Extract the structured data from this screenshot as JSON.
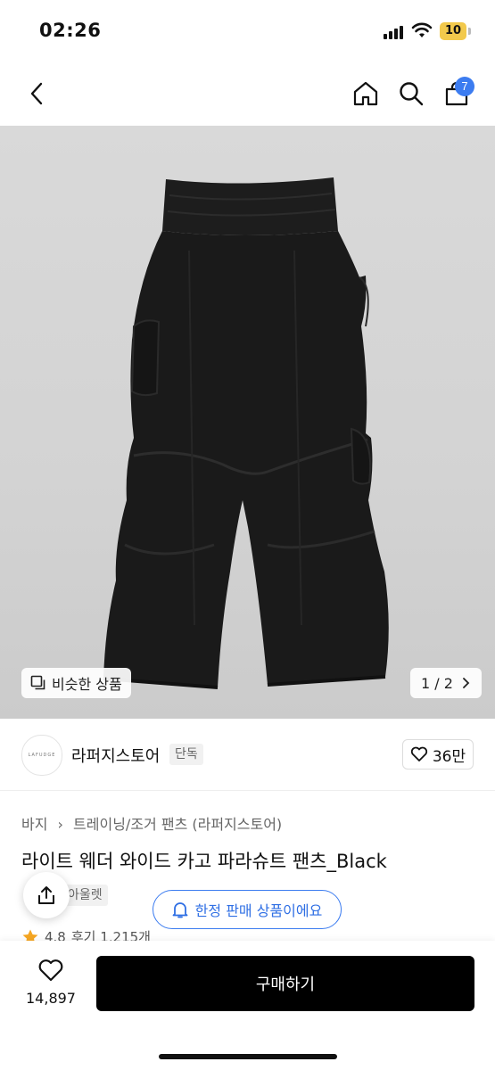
{
  "status_bar": {
    "time": "02:26",
    "battery": "10"
  },
  "nav": {
    "cart_count": "7"
  },
  "gallery": {
    "similar_label": "비슷한 상품",
    "pager": "1 / 2"
  },
  "store": {
    "logo_text": "LAFUDGE",
    "name": "라퍼지스토어",
    "exclusive_badge": "단독",
    "likes": "36만"
  },
  "product": {
    "breadcrumb": [
      "바지",
      "트레이닝/조거 팬츠 (라퍼지스토어)"
    ],
    "title": "라이트 웨더 와이드 카고 파라슈트 팬츠_Black",
    "tag": "아울렛",
    "limited_label": "한정 판매 상품이에요",
    "rating": "4.8",
    "reviews": "후기 1,215개"
  },
  "bottom_bar": {
    "wish_count": "14,897",
    "buy_label": "구매하기"
  },
  "colors": {
    "accent": "#3c7cf0",
    "buy_button": "#000000",
    "star": "#f5a623"
  },
  "icons": [
    "back-icon",
    "home-icon",
    "search-icon",
    "cart-icon",
    "heart-icon",
    "share-icon",
    "bell-icon",
    "star-icon",
    "copy-icon",
    "chevron-right-icon"
  ]
}
